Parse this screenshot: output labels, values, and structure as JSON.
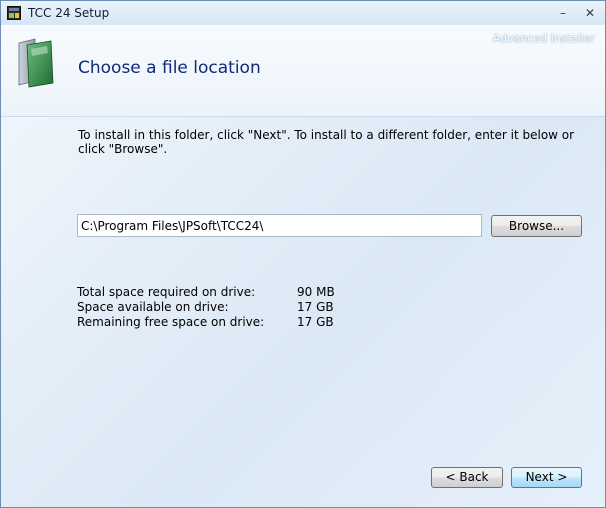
{
  "window": {
    "title": "TCC 24 Setup",
    "minimize_glyph": "–",
    "close_glyph": "✕",
    "app_icon": "setup-app-icon"
  },
  "header": {
    "brand": "Advanced Installer",
    "title": "Choose a file location",
    "icon": "folder-icon"
  },
  "instructions": "To install in this folder, click \"Next\". To install to a different folder, enter it below or click \"Browse\".",
  "path": {
    "value": "C:\\Program Files\\JPSoft\\TCC24\\"
  },
  "buttons": {
    "browse": "Browse...",
    "back": "< Back",
    "next": "Next >"
  },
  "space": [
    {
      "label": "Total space required on drive:",
      "value": "90 MB"
    },
    {
      "label": "Space available on drive:",
      "value": "17 GB"
    },
    {
      "label": "Remaining free space on drive:",
      "value": "17 GB"
    }
  ]
}
